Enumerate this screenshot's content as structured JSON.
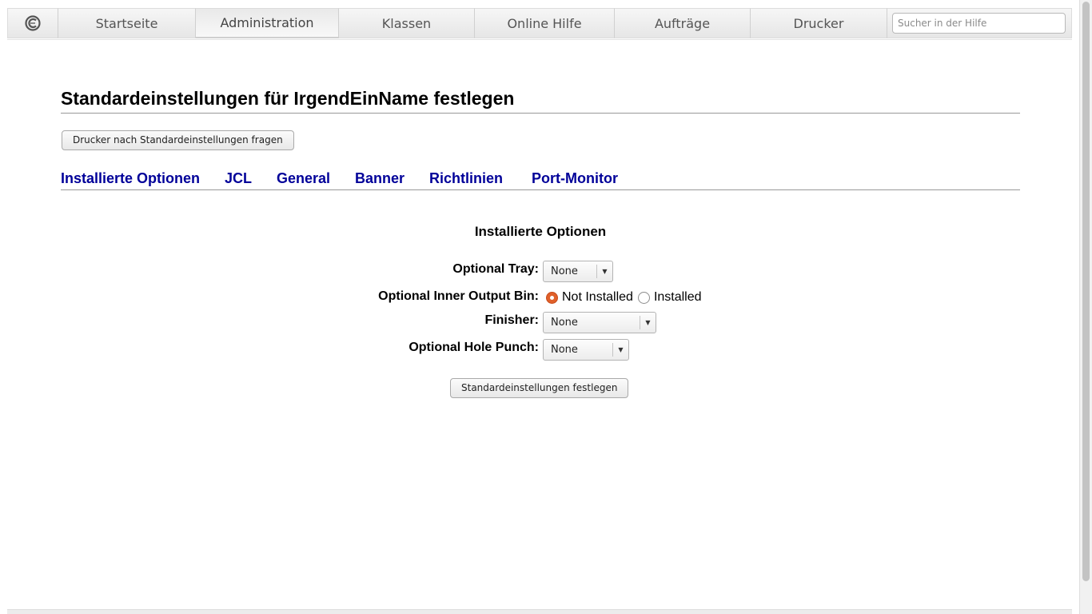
{
  "nav": {
    "tabs": [
      {
        "label": "Startseite"
      },
      {
        "label": "Administration"
      },
      {
        "label": "Klassen"
      },
      {
        "label": "Online Hilfe"
      },
      {
        "label": "Aufträge"
      },
      {
        "label": "Drucker"
      }
    ],
    "active_tab": "Administration",
    "search_placeholder": "Sucher in der Hilfe"
  },
  "page": {
    "title": "Standardeinstellungen für IrgendEinName festlegen",
    "query_button": "Drucker nach Standardeinstellungen fragen"
  },
  "sections": {
    "links": [
      {
        "label": "Installierte Optionen"
      },
      {
        "label": "JCL"
      },
      {
        "label": "General"
      },
      {
        "label": "Banner"
      },
      {
        "label": "Richtlinien"
      },
      {
        "label": "Port-Monitor"
      }
    ]
  },
  "form": {
    "heading": "Installierte Optionen",
    "optional_tray": {
      "label": "Optional Tray:",
      "value": "None"
    },
    "output_bin": {
      "label": "Optional Inner Output Bin:",
      "options": [
        {
          "label": "Not Installed",
          "checked": true
        },
        {
          "label": "Installed",
          "checked": false
        }
      ]
    },
    "finisher": {
      "label": "Finisher:",
      "value": "None"
    },
    "hole_punch": {
      "label": "Optional Hole Punch:",
      "value": "None"
    },
    "submit_button": "Standardeinstellungen festlegen"
  },
  "colors": {
    "link": "#000099",
    "radio_checked": "#e0602a"
  }
}
